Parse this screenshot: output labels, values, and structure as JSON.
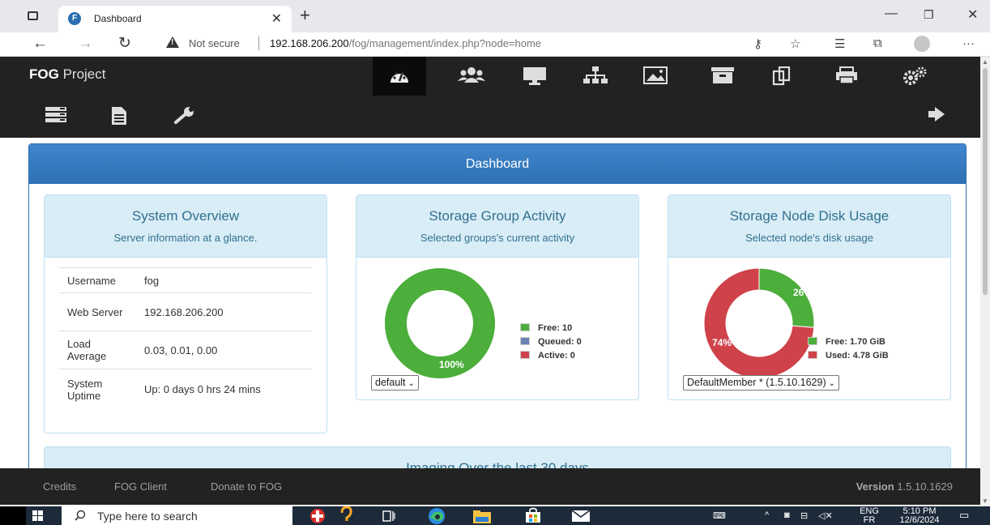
{
  "browser": {
    "tab_title": "Dashboard",
    "tab_favicon_letter": "F",
    "new_tab": "+",
    "not_secure": "Not secure",
    "url_host": "192.168.206.200",
    "url_path": "/fog/management/index.php?node=home"
  },
  "fog": {
    "brand_bold": "FOG",
    "brand_rest": "Project",
    "nav": [
      "dashboard-icon",
      "users-icon",
      "hosts-icon",
      "groups-icon",
      "images-icon",
      "storage-icon",
      "snapins-icon",
      "printers-icon",
      "settings-icon"
    ],
    "subnav": [
      "tasks-icon",
      "reports-icon",
      "plugins-icon",
      "logout-icon"
    ]
  },
  "dashboard": {
    "title": "Dashboard",
    "system_overview": {
      "title": "System Overview",
      "subtitle": "Server information at a glance.",
      "rows": [
        {
          "label": "Username",
          "value": "fog"
        },
        {
          "label": "Web Server",
          "value": "192.168.206.200"
        },
        {
          "label": "Load Average",
          "value": "0.03, 0.01, 0.00"
        },
        {
          "label": "System Uptime",
          "value": "Up: 0 days 0 hrs 24 mins"
        }
      ]
    },
    "storage_group": {
      "title": "Storage Group Activity",
      "subtitle": "Selected groups's current activity",
      "percent_label": "100%",
      "legend": [
        "Free: 10",
        "Queued: 0",
        "Active: 0"
      ],
      "select_value": "default"
    },
    "storage_node": {
      "title": "Storage Node Disk Usage",
      "subtitle": "Selected node's disk usage",
      "free_label": "26%",
      "used_label": "74%",
      "legend": [
        "Free: 1.70 GiB",
        "Used: 4.78 GiB"
      ],
      "select_value": "DefaultMember * (1.5.10.1629)"
    },
    "imaging_title": "Imaging Over the last 30 days"
  },
  "chart_data": [
    {
      "type": "pie",
      "title": "Storage Group Activity",
      "labels": [
        "Free",
        "Queued",
        "Active"
      ],
      "values": [
        10,
        0,
        0
      ],
      "colors": [
        "#4cae3b",
        "#6b82b5",
        "#d0424a"
      ]
    },
    {
      "type": "pie",
      "title": "Storage Node Disk Usage",
      "labels": [
        "Free",
        "Used"
      ],
      "values": [
        1.7,
        4.78
      ],
      "unit": "GiB",
      "colors": [
        "#4cae3b",
        "#d0424a"
      ]
    }
  ],
  "footer": {
    "links": [
      "Credits",
      "FOG Client",
      "Donate to FOG"
    ],
    "version_label": "Version",
    "version_value": "1.5.10.1629"
  },
  "taskbar": {
    "search_placeholder": "Type here to search",
    "lang_top": "ENG",
    "lang_bottom": "FR",
    "time": "5:10 PM",
    "date": "12/6/2024"
  },
  "colors": {
    "header": "#222222",
    "panel_blue": "#337ab7",
    "card_head": "#d9edf7",
    "free_green": "#4cae3b",
    "used_red": "#d0424a",
    "queued_blue": "#6b82b5"
  }
}
